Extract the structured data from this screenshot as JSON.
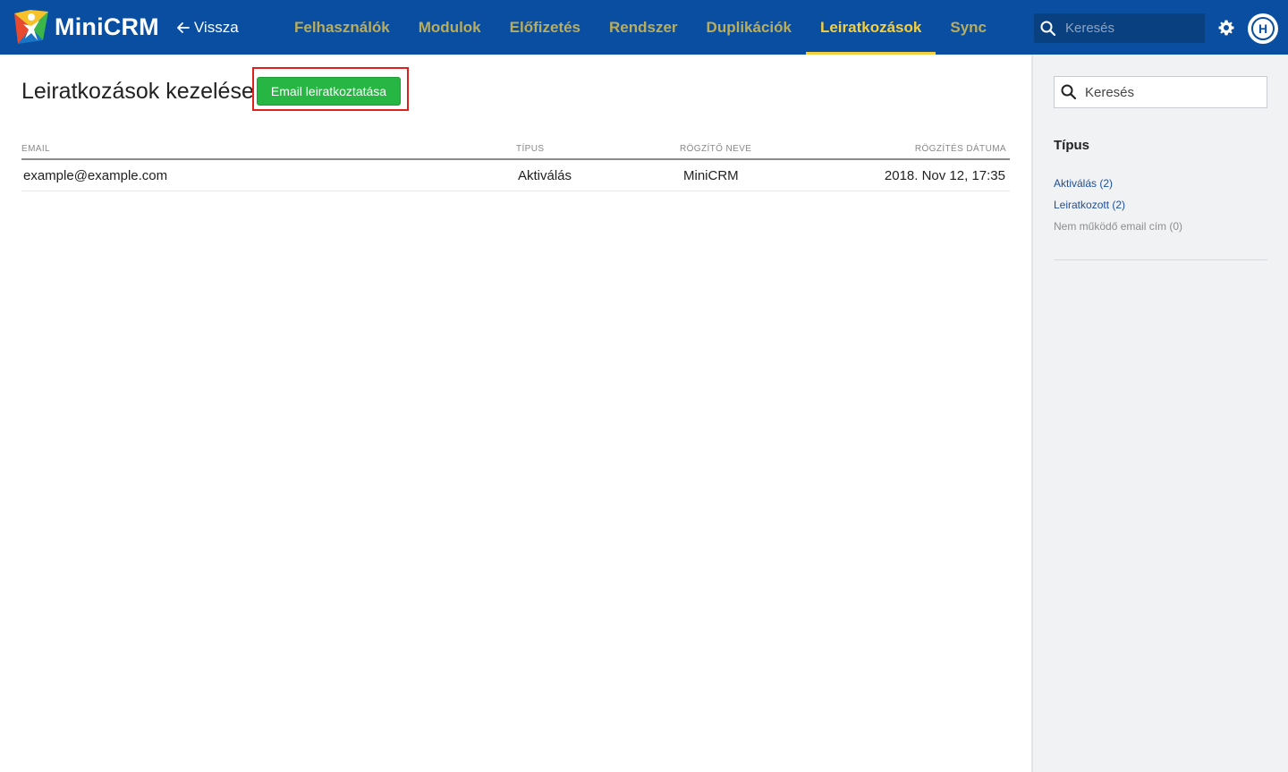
{
  "header": {
    "brand": "MiniCRM",
    "back_label": "Vissza",
    "nav": [
      {
        "label": "Felhasználók",
        "active": false
      },
      {
        "label": "Modulok",
        "active": false
      },
      {
        "label": "Előfizetés",
        "active": false
      },
      {
        "label": "Rendszer",
        "active": false
      },
      {
        "label": "Duplikációk",
        "active": false
      },
      {
        "label": "Leiratkozások",
        "active": true
      },
      {
        "label": "Sync",
        "active": false
      }
    ],
    "search_placeholder": "Keresés",
    "avatar_initial": "H",
    "colors": {
      "bar": "#0a4ea1",
      "nav_inactive": "#b9ad5c",
      "nav_active": "#f5cf3c"
    }
  },
  "main": {
    "title": "Leiratkozások kezelése",
    "primary_button": "Email leiratkoztatása",
    "table": {
      "columns": [
        "EMAIL",
        "TÍPUS",
        "RÖGZÍTŐ NEVE",
        "RÖGZÍTÉS DÁTUMA"
      ],
      "rows": [
        [
          "example@example.com",
          "Aktiválás",
          "MiniCRM",
          "2018. Nov 12, 17:35"
        ]
      ]
    },
    "colors": {
      "button": "#27b543",
      "highlight": "#e0201c"
    }
  },
  "sidebar": {
    "search_placeholder": "Keresés",
    "filter_title": "Típus",
    "filters": [
      {
        "label": "Aktiválás (2)",
        "enabled": true
      },
      {
        "label": "Leiratkozott (2)",
        "enabled": true
      },
      {
        "label": "Nem működő email cím (0)",
        "enabled": false
      }
    ]
  }
}
